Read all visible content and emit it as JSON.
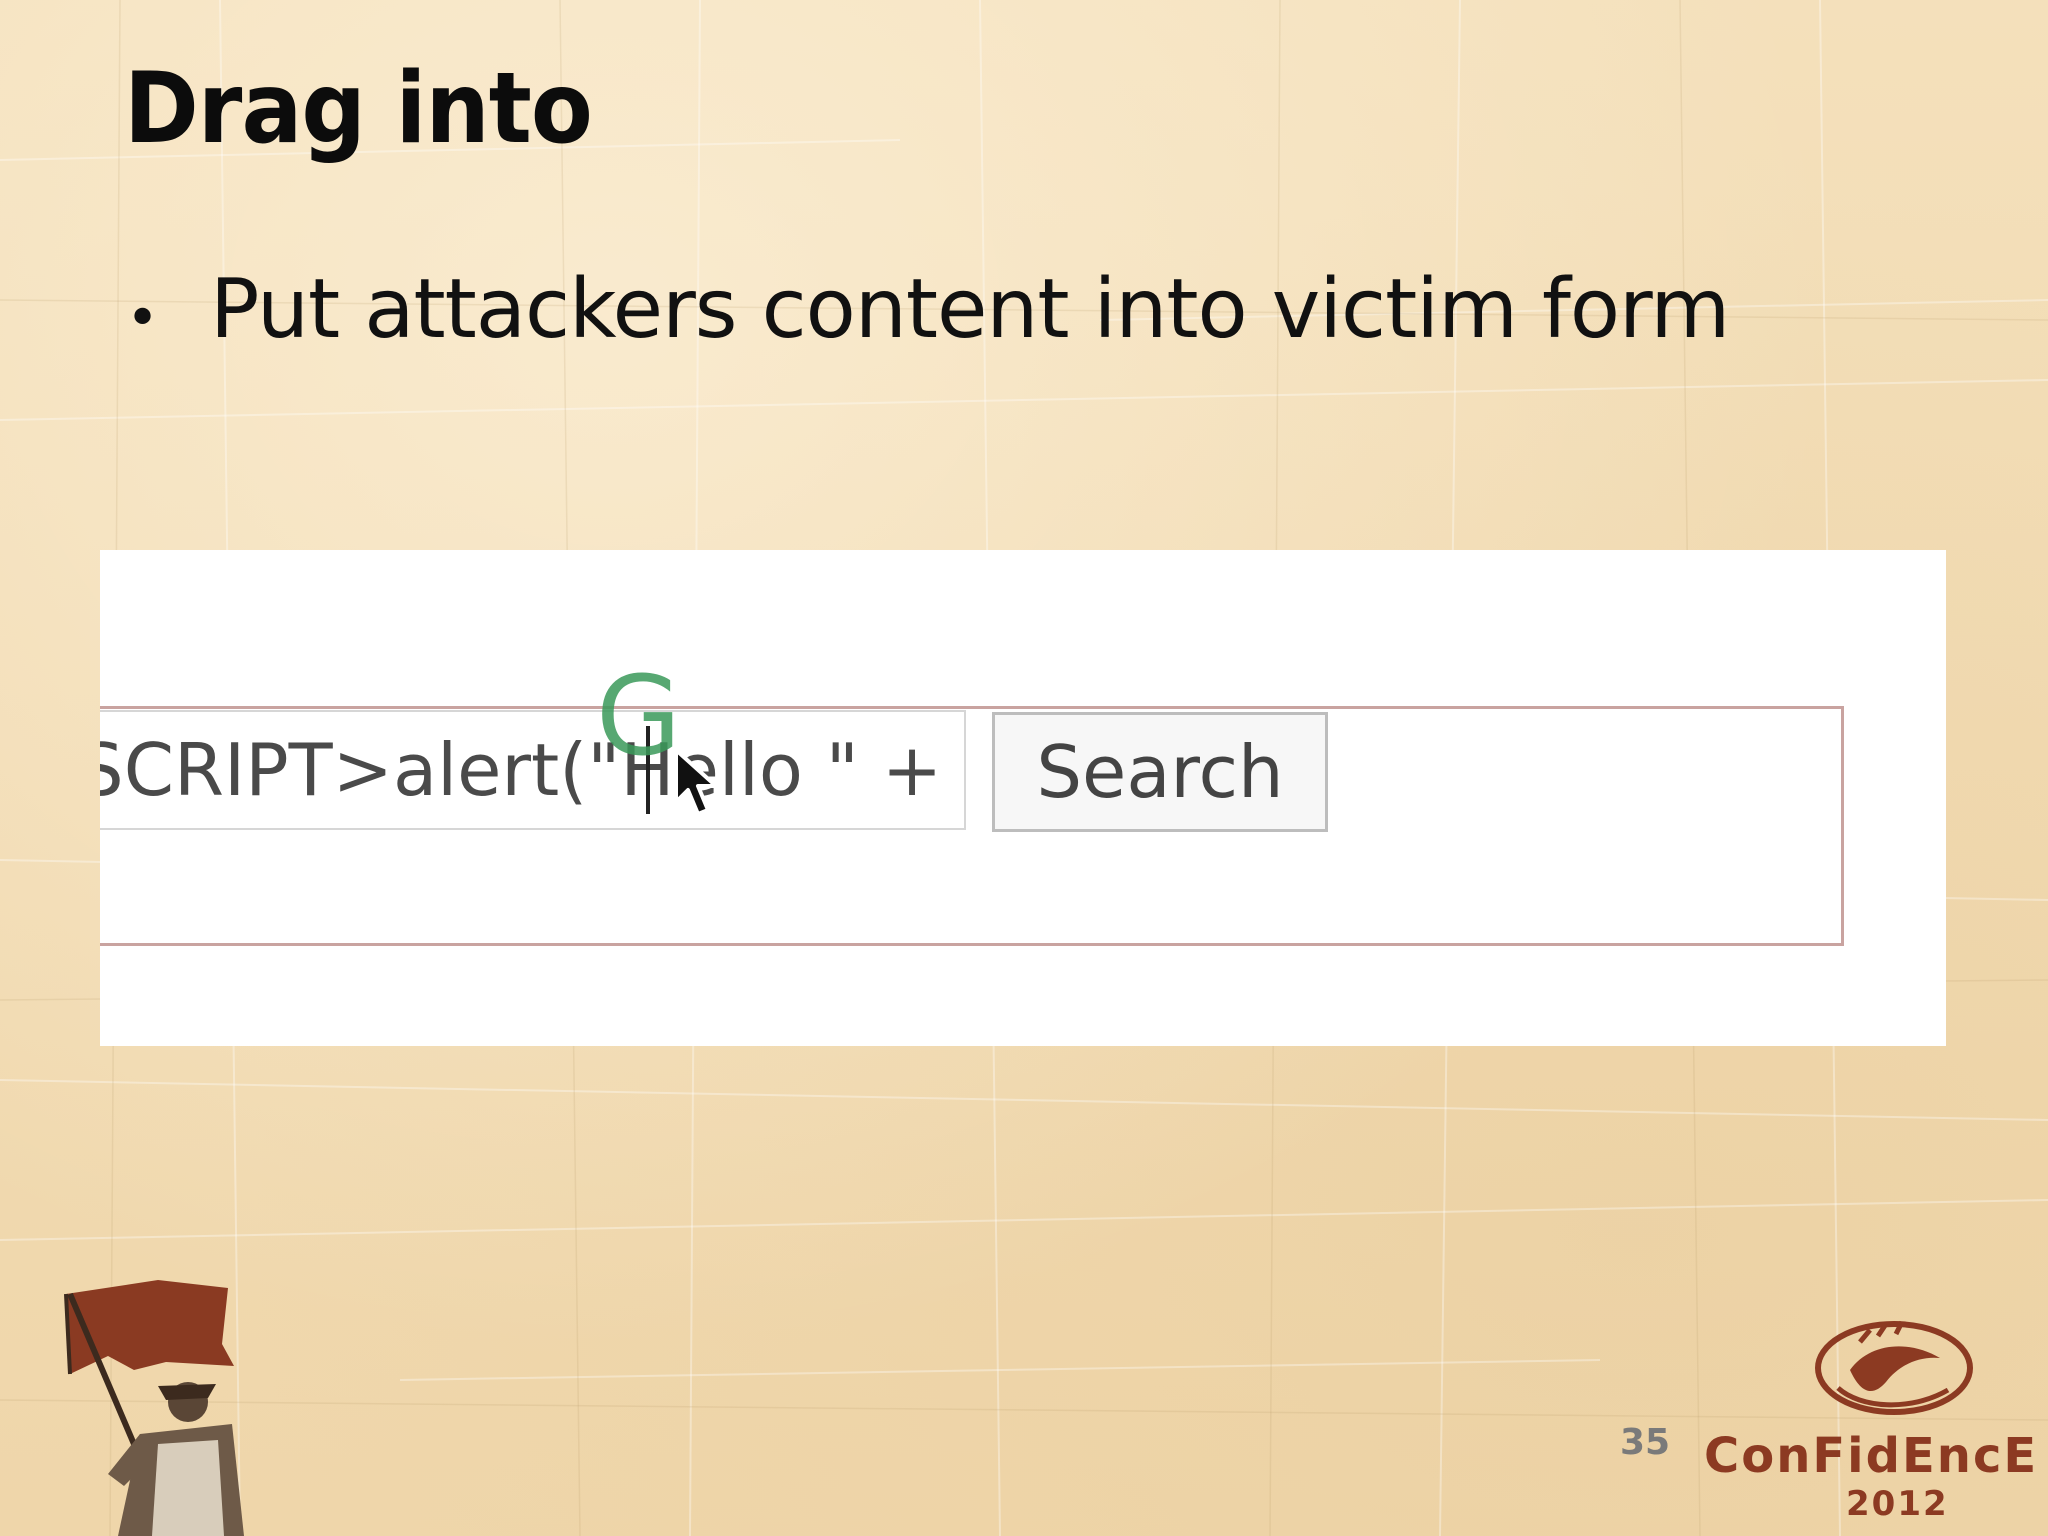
{
  "slide": {
    "title": "Drag into",
    "bullets": [
      {
        "text": "Put attackers content into victim form"
      }
    ],
    "page_number": "35"
  },
  "screenshot": {
    "search_input": {
      "value": "SCRIPT>alert(\"Hello \" +"
    },
    "search_button_label": "Search",
    "drag_indicator": "G"
  },
  "branding": {
    "name": "ConFidEncE",
    "year": "2012"
  },
  "colors": {
    "background": "#f2dcb4",
    "title": "#0c0c0c",
    "brand": "#8c3a22",
    "flag": "#8a3a22",
    "drag_indicator": "#3a9a5a"
  },
  "icons": [
    "cursor-arrow-icon",
    "drag-copy-icon",
    "flag-bearer-logo",
    "confidence-logo"
  ]
}
